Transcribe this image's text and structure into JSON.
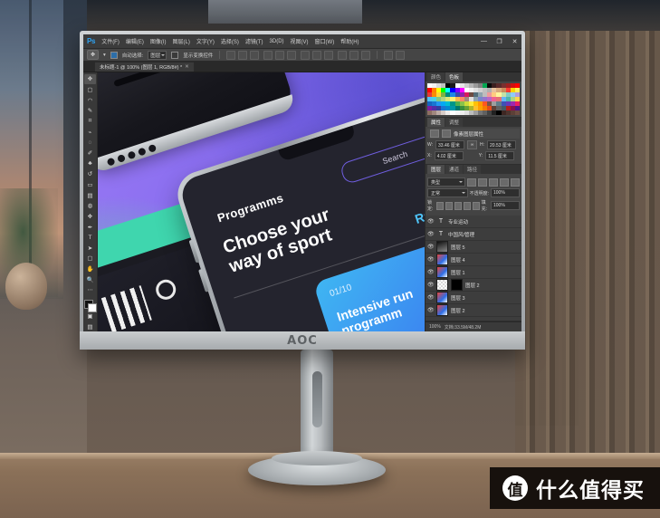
{
  "scene": {
    "description": "AOC monitor on desk running Adobe Photoshop",
    "monitor_brand": "AOC"
  },
  "photoshop": {
    "app_logo": "Ps",
    "menus": [
      "文件(F)",
      "编辑(E)",
      "图像(I)",
      "图层(L)",
      "文字(Y)",
      "选择(S)",
      "滤镜(T)",
      "3D(D)",
      "视图(V)",
      "窗口(W)",
      "帮助(H)"
    ],
    "window_controls": {
      "minimize": "—",
      "maximize": "❐",
      "close": "✕"
    },
    "options_bar": {
      "tool_icon": "move-tool",
      "auto_select_label": "自动选择:",
      "auto_select_value": "图层",
      "show_transform_label": "显示变换控件",
      "align_group": [
        "align-left",
        "align-center-h",
        "align-right",
        "align-top",
        "align-middle",
        "align-bottom"
      ],
      "distribute_group": [
        "dist-left",
        "dist-center-h",
        "dist-right",
        "dist-top",
        "dist-middle",
        "dist-bottom"
      ]
    },
    "document_tab": {
      "label": "未标题-1 @ 100% (图层 1, RGB/8#) *",
      "close": "✕"
    },
    "tools": [
      "move-tool",
      "marquee-tool",
      "lasso-tool",
      "quick-select-tool",
      "crop-tool",
      "eyedropper-tool",
      "healing-brush-tool",
      "brush-tool",
      "clone-stamp-tool",
      "history-brush-tool",
      "eraser-tool",
      "gradient-tool",
      "blur-tool",
      "dodge-tool",
      "pen-tool",
      "type-tool",
      "path-select-tool",
      "rectangle-tool",
      "hand-tool",
      "zoom-tool",
      "more-tools"
    ],
    "color_panel": {
      "tabs": [
        "颜色",
        "色板"
      ],
      "active_tab": "色板"
    },
    "properties_panel": {
      "tabs": [
        "属性",
        "调整"
      ],
      "active_tab": "属性",
      "header": "像素图层属性",
      "fields": [
        {
          "label": "W:",
          "value": "33.46 厘米"
        },
        {
          "label": "H:",
          "value": "20.53 厘米"
        },
        {
          "label": "X:",
          "value": "4.02 厘米"
        },
        {
          "label": "Y:",
          "value": "11.5 厘米"
        }
      ],
      "link_icon": "link-icon"
    },
    "layers_panel": {
      "tabs": [
        "图层",
        "通道",
        "路径"
      ],
      "active_tab": "图层",
      "filter_label": "类型",
      "blend_mode": "正常",
      "opacity_label": "不透明度:",
      "opacity_value": "100%",
      "lock_label": "锁定:",
      "fill_label": "填充:",
      "fill_value": "100%",
      "lock_icons": [
        "lock-transparent-icon",
        "lock-image-icon",
        "lock-position-icon",
        "lock-artboard-icon",
        "lock-all-icon"
      ],
      "layers": [
        {
          "name": "专业运动",
          "kind": "text",
          "visible": true
        },
        {
          "name": "中国风/管理",
          "kind": "text",
          "visible": true
        },
        {
          "name": "图层 5",
          "kind": "pixel",
          "visible": true
        },
        {
          "name": "图层 4",
          "kind": "pixel",
          "visible": true
        },
        {
          "name": "图层 1",
          "kind": "pixel",
          "visible": true
        },
        {
          "name": "图层 2",
          "kind": "pixel-mask",
          "visible": true
        },
        {
          "name": "图层 3",
          "kind": "pixel",
          "visible": true
        },
        {
          "name": "图层 2",
          "kind": "pixel",
          "visible": true
        }
      ]
    },
    "status_bar": {
      "zoom": "100%",
      "doc_size": "文档:33.5M/48.2M"
    }
  },
  "artwork": {
    "phone_ui": {
      "nav_title": "Programms",
      "search_placeholder": "Search",
      "headline_line1": "Choose your",
      "headline_line2": "way of sport",
      "category": "Running",
      "card": {
        "counter": "01/10",
        "title_line1": "Intensive run",
        "title_line2": "programm"
      }
    }
  },
  "watermark": {
    "badge": "值",
    "text": "什么值得买"
  },
  "colors": {
    "ps_chrome": "#3a3a3a",
    "ps_accent": "#2ea3f2",
    "artwork_purple": "#8f6ff0",
    "artwork_teal": "#3fd6ae",
    "card_blue": "#3fb6f2",
    "running_blue": "#4fc3f7"
  }
}
